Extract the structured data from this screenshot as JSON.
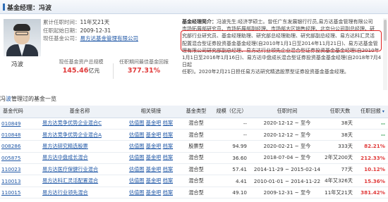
{
  "header": {
    "title": "基金经理：冯波"
  },
  "manager": {
    "name": "冯波",
    "info": [
      {
        "key": "累计任职时间：",
        "value": "11年又21天"
      },
      {
        "key": "任职起始日期：",
        "value": "2009-12-31"
      },
      {
        "key": "现任基金公司：",
        "value": "易方达基金管理有限公司",
        "link": true
      }
    ],
    "stats": {
      "aum_label": "现任基金资产总规模",
      "aum_value": "145.46",
      "aum_unit": "亿元",
      "return_label": "任职期间最佳基金回报",
      "return_value": "377.31%"
    },
    "bio_head": "基金经理简介：",
    "bio_lines": [
      "冯波先生:经济学硕士。曾任广东发展银行行员,易方达基金管理有限公司",
      "市场拓展部研究员、市场拓展部副经理、市场部大区销售经理、北京分公司副总经理、研",
      "究部行业研究员、基金经理助理、研究部总经理助理、研究部副总经理、易方达科汇灵活",
      "配置混合型证券投资基金基金经理(自2010年1月1日至2014年11月21日)、易方达基金管",
      "理有限公司研究部副总经理、易方达行业领先企业混合型证券投资基金基金经理(自2010年",
      "1月1日至2016年1月16日)、易方达中盘成长混合型证券投资基金基金经理(自2018年7月4日起",
      "任职)。2020年2月21日担任易方达研究精选股票型证券投资基金基金经理。"
    ]
  },
  "section": {
    "title_prefix": "冯",
    "title_accent": "波",
    "title_suffix": "管理过的基金一览"
  },
  "columns": [
    "基金代码",
    "基金名称",
    "相关链接",
    "基金类型",
    "规模（亿元）",
    "任职时间",
    "任职天数",
    "任职回报"
  ],
  "link_labels": [
    "估值图",
    "基金吧",
    "档案"
  ],
  "funds": [
    {
      "code": "010849",
      "name": "易方达竞争优势企业混合C",
      "type": "混合型",
      "size": "--",
      "period": "2020-12-12 ~ 至今",
      "days": "38天",
      "ret": "--"
    },
    {
      "code": "010848",
      "name": "易方达竞争优势企业混合A",
      "type": "混合型",
      "size": "--",
      "period": "2020-12-12 ~ 至今",
      "days": "38天",
      "ret": "--"
    },
    {
      "code": "008286",
      "name": "易方达研究精选股票",
      "type": "股票型",
      "size": "94.99",
      "period": "2020-02-21 ~ 至今",
      "days": "333天",
      "ret": "82.21%"
    },
    {
      "code": "005875",
      "name": "易方达中盘成长混合",
      "type": "混合型",
      "size": "36.60",
      "period": "2018-07-04 ~ 至今",
      "days": "2年又200天",
      "ret": "212.33%"
    },
    {
      "code": "110023",
      "name": "易方达医疗保健行业混合",
      "type": "混合型",
      "size": "57.41",
      "period": "2014-11-29 ~ 2015-02-14",
      "days": "77天",
      "ret": "10.12%"
    },
    {
      "code": "110013",
      "name": "易方达科汇灵活配置混合",
      "type": "混合型",
      "size": "4.41",
      "period": "2010-01-01 ~ 2014-11-22",
      "days": "4年又326天",
      "ret": "15.36%"
    },
    {
      "code": "110015",
      "name": "易方达行业领先混合",
      "type": "混合型",
      "size": "49.10",
      "period": "2009-12-31 ~ 至今",
      "days": "11年又21天",
      "ret": "381.42%"
    }
  ]
}
